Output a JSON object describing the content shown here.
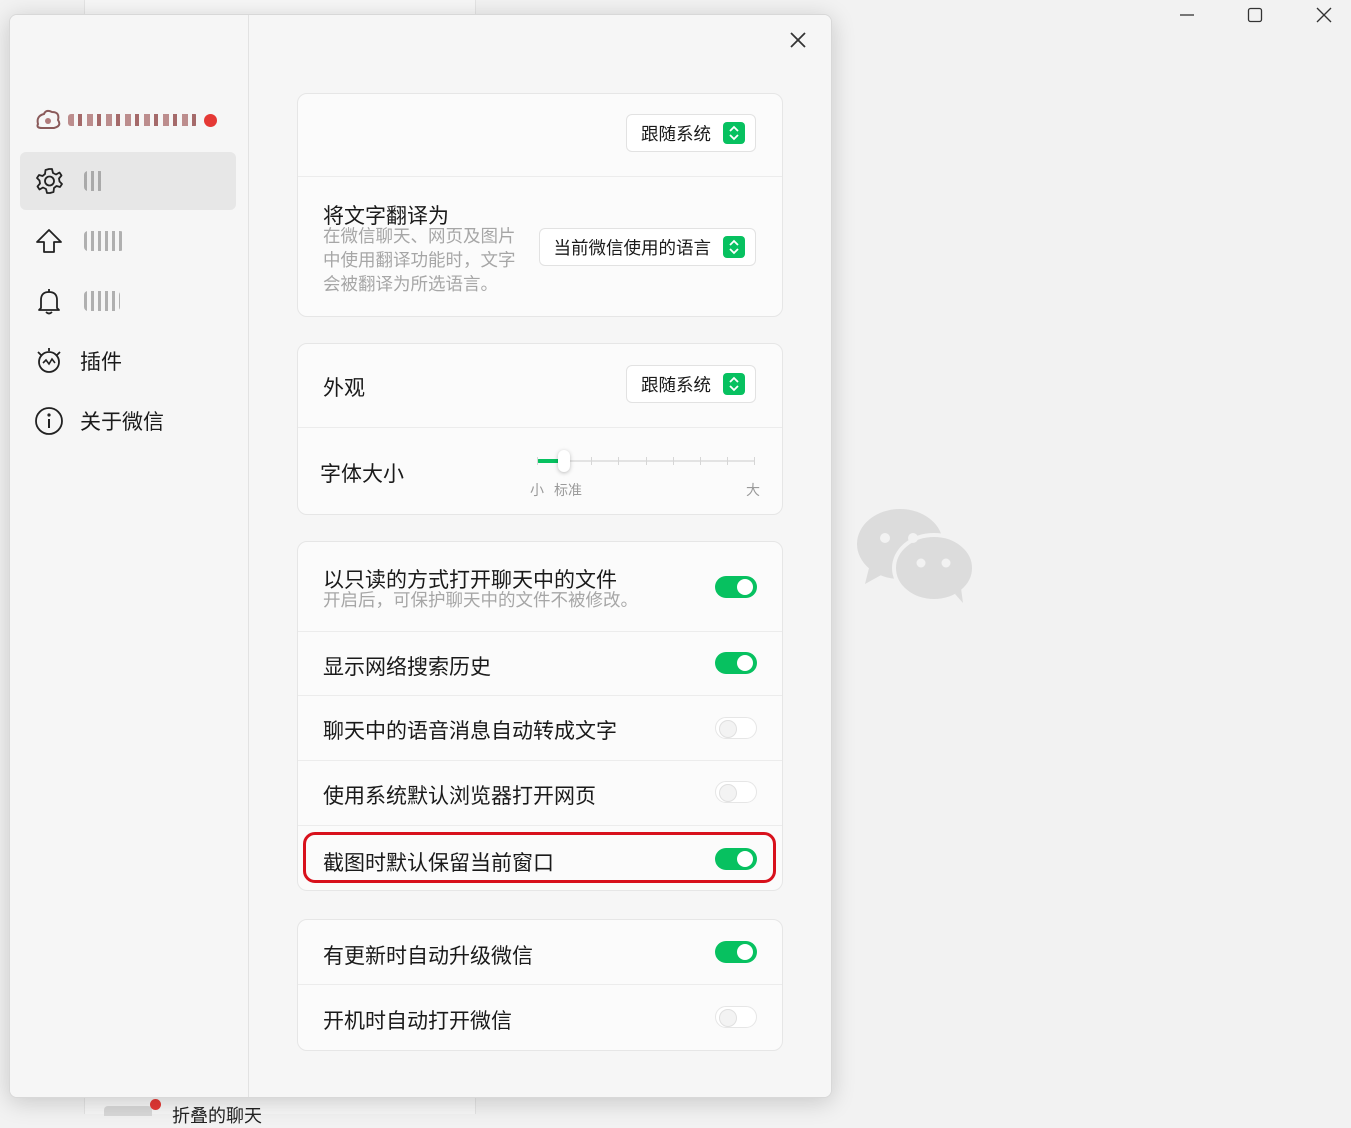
{
  "background": {
    "bottom_chat_preview": "折叠的聊天"
  },
  "window_controls": {
    "minimize_icon": "minimize-icon",
    "maximize_icon": "maximize-icon",
    "close_icon": "close-icon"
  },
  "sidebar": {
    "items": [
      {
        "icon": "gear-icon",
        "label": ""
      },
      {
        "icon": "arrow-up-icon",
        "label": ""
      },
      {
        "icon": "bell-icon",
        "label": ""
      },
      {
        "icon": "plugin-icon",
        "label": "插件"
      },
      {
        "icon": "info-icon",
        "label": "关于微信"
      }
    ]
  },
  "general": {
    "language_select": "跟随系统",
    "translate": {
      "title": "将文字翻译为",
      "description_lines": [
        "在微信聊天、网页及图片",
        "中使用翻译功能时，文字",
        "会被翻译为所选语言。"
      ],
      "select": "当前微信使用的语言"
    },
    "appearance": {
      "title": "外观",
      "select": "跟随系统"
    },
    "font_size": {
      "title": "字体大小",
      "label_small": "小",
      "label_standard": "标准",
      "label_large": "大",
      "steps": 9,
      "current_step": 1
    },
    "toggles_group1": [
      {
        "title": "以只读的方式打开聊天中的文件",
        "description": "开启后，可保护聊天中的文件不被修改。",
        "on": true
      },
      {
        "title": "显示网络搜索历史",
        "on": true
      },
      {
        "title": "聊天中的语音消息自动转成文字",
        "on": false
      },
      {
        "title": "使用系统默认浏览器打开网页",
        "on": false
      },
      {
        "title": "截图时默认保留当前窗口",
        "on": true
      }
    ],
    "toggles_group2": [
      {
        "title": "有更新时自动升级微信",
        "on": true
      },
      {
        "title": "开机时自动打开微信",
        "on": false
      }
    ]
  },
  "colors": {
    "accent": "#07c160",
    "highlight": "#d8111c",
    "notification_dot": "#e53935"
  }
}
